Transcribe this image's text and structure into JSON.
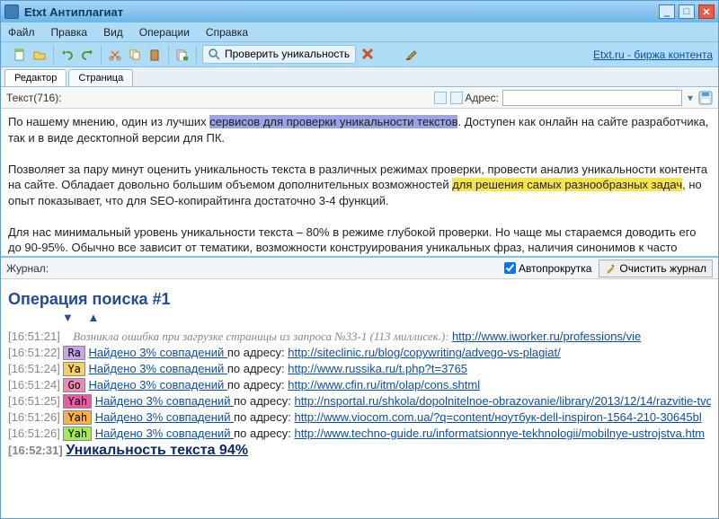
{
  "title": "Etxt Антиплагиат",
  "menu": {
    "file": "Файл",
    "edit": "Правка",
    "view": "Вид",
    "ops": "Операции",
    "help": "Справка"
  },
  "toolbar": {
    "check_label": "Проверить уникальность",
    "promo_link": "Etxt.ru - биржа контента"
  },
  "tabs": {
    "editor": "Редактор",
    "page": "Страница"
  },
  "editor_bar": {
    "text_label": "Текст(716):",
    "addr_label": "Адрес:",
    "addr_value": ""
  },
  "text": {
    "p1a": "По нашему мнению, один из лучших ",
    "p1b": "сервисов для проверки уникальности текстов",
    "p1c": ". Доступен как онлайн на сайте разработчика, так и в виде десктопной версии для ПК.",
    "p2a": "Позволяет за пару минут оценить уникальность текста в различных режимах проверки, провести анализ уникальности контента на сайте. Обладает довольно большим объемом дополнительных возможностей ",
    "p2b": "для решения самых разнообразных задач",
    "p2c": ", но опыт показывает, что для SEO-копирайтинга достаточно 3-4 функций.",
    "p3": "Для нас минимальный уровень уникальности текста – 80% в режиме глубокой проверки. Но чаще мы стараемся доводить его до 90-95%. Обычно все зависит от тематики, возможности конструирования уникальных фраз, наличия синонимов к часто повторяющимся словам."
  },
  "journal_bar": {
    "label": "Журнал:",
    "autoscroll": "Автопрокрутка",
    "clear": "Очистить журнал"
  },
  "journal": {
    "op_title": "Операция поиска #1",
    "arrows": "▼  ▲",
    "err_ts": "[16:51:21]",
    "err_msg": "Возникла ошибка при загрузке страницы из запроса №33-1 (113 миллисек.): ",
    "err_url": "http://www.iworker.ru/professions/vie",
    "lines": [
      {
        "ts": "[16:51:22]",
        "badge": "Ra",
        "bclass": "b-ra",
        "found": "Найдено 3% совпадений ",
        "mid": "по адресу: ",
        "url": "http://siteclinic.ru/blog/copywriting/advego-vs-plagiat/"
      },
      {
        "ts": "[16:51:24]",
        "badge": "Ya",
        "bclass": "b-ya",
        "found": "Найдено 3% совпадений ",
        "mid": "по адресу: ",
        "url": "http://www.russika.ru/t.php?t=3765"
      },
      {
        "ts": "[16:51:24]",
        "badge": "Go",
        "bclass": "b-go",
        "found": "Найдено 3% совпадений ",
        "mid": "по адресу: ",
        "url": "http://www.cfin.ru/itm/olap/cons.shtml"
      },
      {
        "ts": "[16:51:25]",
        "badge": "Yah",
        "bclass": "b-yah1",
        "found": "Найдено 3% совпадений ",
        "mid": "по адресу: ",
        "url": "http://nsportal.ru/shkola/dopolnitelnoe-obrazovanie/library/2013/12/14/razvitie-tvo"
      },
      {
        "ts": "[16:51:26]",
        "badge": "Yah",
        "bclass": "b-yah2",
        "found": "Найдено 3% совпадений ",
        "mid": "по адресу: ",
        "url": "http://www.viocom.com.ua/?q=content/ноутбук-dell-inspiron-1564-210-30645bl"
      },
      {
        "ts": "[16:51:26]",
        "badge": "Yah",
        "bclass": "b-yah3",
        "found": "Найдено 3% совпадений ",
        "mid": "по адресу: ",
        "url": "http://www.techno-guide.ru/informatsionnye-tekhnologii/mobilnye-ustrojstva.htm"
      }
    ],
    "uniq_ts": "[16:52:31]",
    "uniq_text": "Уникальность текста 94%"
  }
}
